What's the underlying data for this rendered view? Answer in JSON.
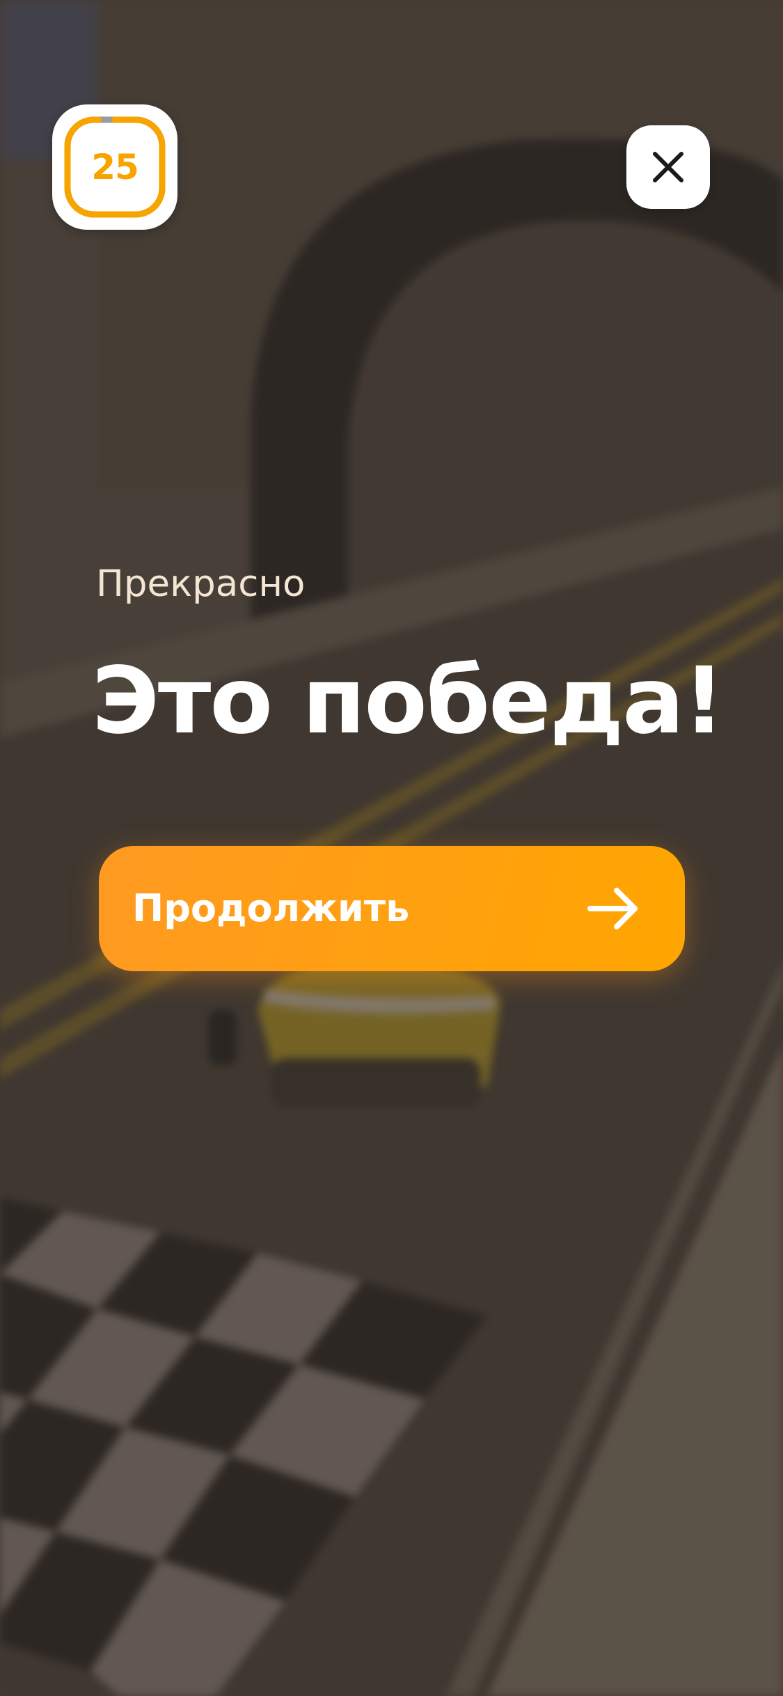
{
  "timer": {
    "value": "25",
    "progress_fraction": 0.95,
    "ring_color": "#f7a400",
    "elapsed_color": "#9b9b9b"
  },
  "close_button": {
    "icon": "close-icon"
  },
  "result": {
    "subtitle": "Прекрасно",
    "headline": "Это победа!"
  },
  "continue_button": {
    "label": "Продолжить",
    "icon": "arrow-right-icon",
    "color": "#ffa00f"
  }
}
